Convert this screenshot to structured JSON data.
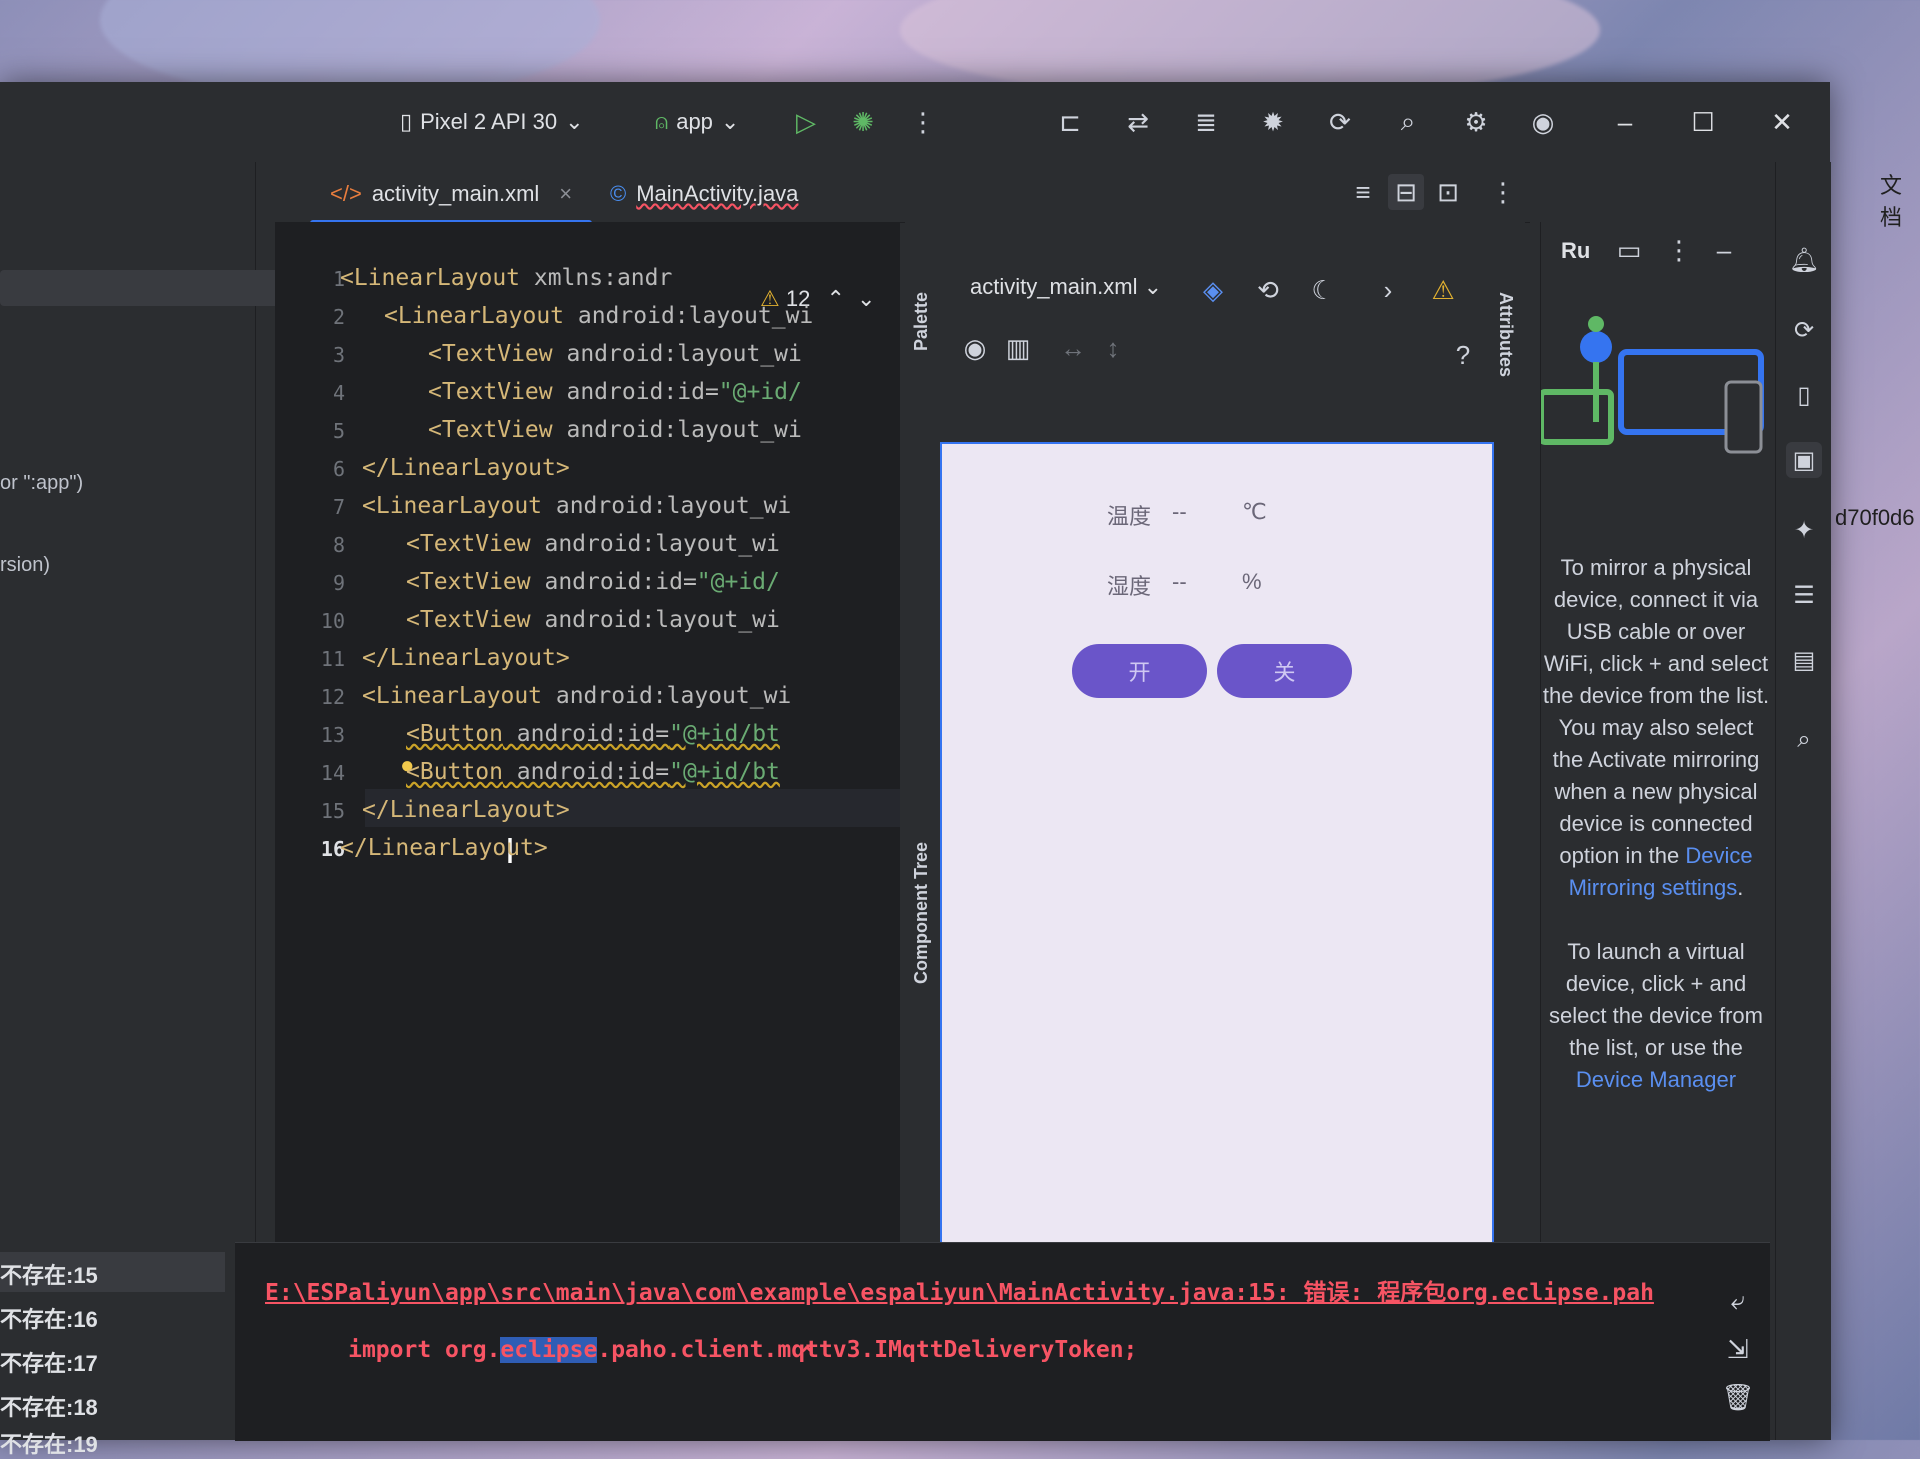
{
  "toolbar": {
    "device": "Pixel 2 API 30",
    "run_config": "app"
  },
  "left_panel": {
    "rows": [
      "or \":app\")",
      "rsion)"
    ]
  },
  "tabs": [
    {
      "label": "activity_main.xml"
    },
    {
      "label": "MainActivity.java"
    }
  ],
  "editor": {
    "warning_count": "12",
    "line_numbers": [
      "1",
      "2",
      "3",
      "4",
      "5",
      "6",
      "7",
      "8",
      "9",
      "10",
      "11",
      "12",
      "13",
      "14",
      "15",
      "16"
    ],
    "lines": [
      {
        "tag": "<LinearLayout",
        "attr": " xmlns:andr"
      },
      {
        "tag": "<LinearLayout",
        "attr": " android:layout_wi"
      },
      {
        "tag": "<TextView",
        "attr": " android:layout_wi"
      },
      {
        "tag": "<TextView",
        "attr": " android:id=",
        "str": "\"@+id/"
      },
      {
        "tag": "<TextView",
        "attr": " android:layout_wi"
      },
      {
        "tag": "</LinearLayout>",
        "attr": ""
      },
      {
        "tag": "<LinearLayout",
        "attr": " android:layout_wi"
      },
      {
        "tag": "<TextView",
        "attr": " android:layout_wi"
      },
      {
        "tag": "<TextView",
        "attr": " android:id=",
        "str": "\"@+id/"
      },
      {
        "tag": "<TextView",
        "attr": " android:layout_wi"
      },
      {
        "tag": "</LinearLayout>",
        "attr": ""
      },
      {
        "tag": "<LinearLayout",
        "attr": " android:layout_wi"
      },
      {
        "tag": "<Button",
        "attr": " android:id=",
        "str": "\"@+id/bt"
      },
      {
        "tag": "<Button",
        "attr": " android:id=",
        "str": "\"@+id/bt"
      },
      {
        "tag": "</LinearLayout>",
        "attr": ""
      },
      {
        "tag": "</LinearLayout>",
        "attr": ""
      }
    ]
  },
  "design": {
    "file_dropdown": "activity_main.xml",
    "palette_label": "Palette",
    "component_tree_label": "Component Tree",
    "attributes_label": "Attributes",
    "help": "?"
  },
  "preview": {
    "temp_label": "温度",
    "temp_value": "--",
    "temp_unit": "℃",
    "humidity_label": "湿度",
    "humidity_value": "--",
    "humidity_unit": "%",
    "on_button": "开",
    "off_button": "关"
  },
  "mirror": {
    "header": "Ru",
    "text1": "To mirror a physical device, connect it via USB cable or over WiFi, click + and select the device from the list. You may also select the Activate mirroring when a new physical device is connected option in the",
    "link1": "Device Mirroring settings",
    "text2": "To launch a virtual device, click + and select the device from the list, or use the",
    "link2": "Device Manager"
  },
  "wallpaper_text": {
    "top_right": "文档",
    "hash": "d70f0d6"
  },
  "console": {
    "error_rows": [
      "不存在:15",
      "不存在:16",
      "不存在:17",
      "不存在:18",
      "不存在:19"
    ],
    "path_line": "E:\\ESPaliyun\\app\\src\\main\\java\\com\\example\\espaliyun\\MainActivity.java:15: 错误: 程序包org.eclipse.pah",
    "import_prefix": "import org.",
    "import_highlight": "eclipse",
    "import_suffix": ".paho.client.mqttv3.IMqttDeliveryToken;",
    "caret": "^"
  },
  "colors": {
    "accent": "#3574f0",
    "run_green": "#5fb865",
    "error_red": "#f75464",
    "button_purple": "#6a55c9"
  }
}
